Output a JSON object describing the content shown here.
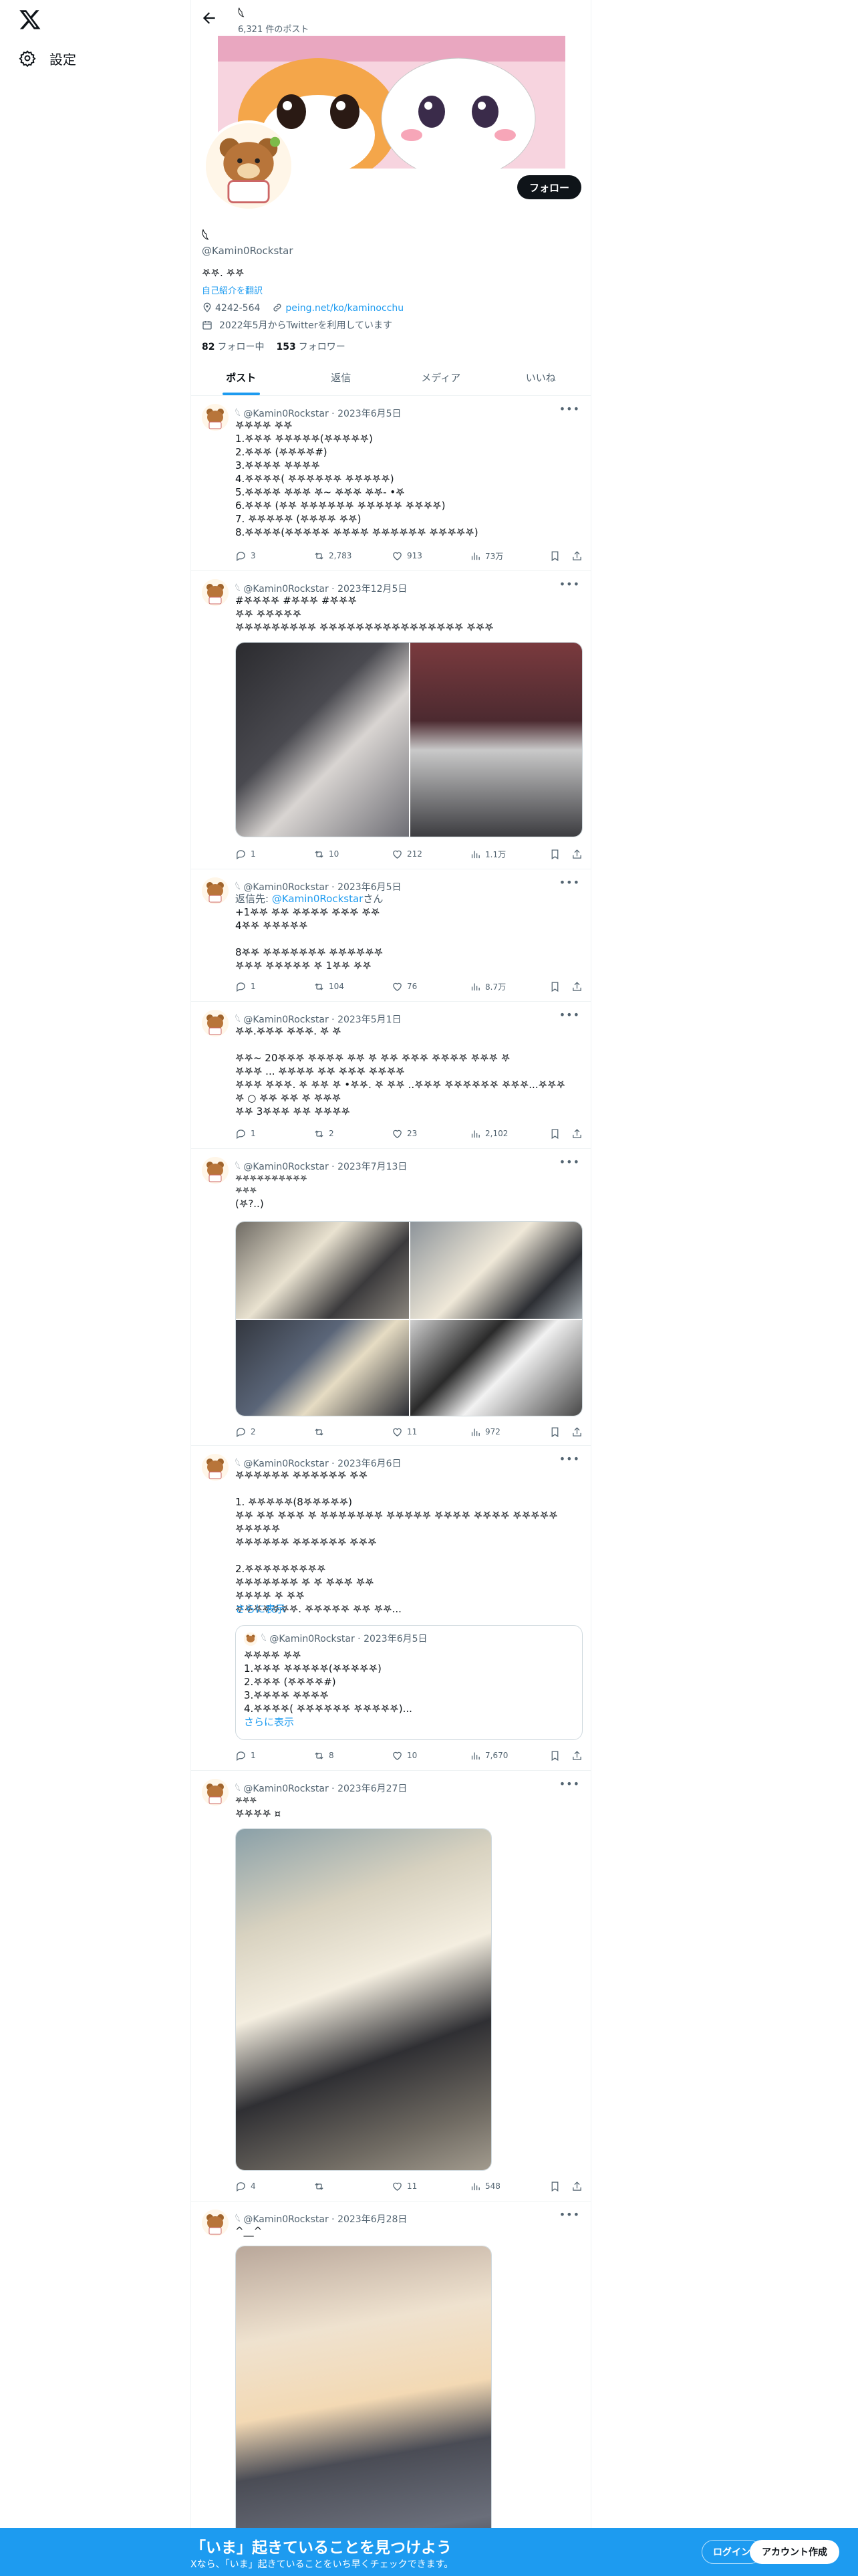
{
  "nav": {
    "settings_label": "設定"
  },
  "profile": {
    "name": "𓆩",
    "post_count": "6,321 件のポスト",
    "handle": "@Kamin0Rockstar",
    "bio": "𖤐𖤐. 𖤐𖤐",
    "translate": "自己紹介を翻訳",
    "location": "4242-564",
    "website": "peing.net/ko/kaminocchu",
    "joined": "2022年5月からTwitterを利用しています",
    "following_count": "82",
    "following_label": "フォロー中",
    "followers_count": "153",
    "followers_label": "フォロワー",
    "follow_button": "フォロー"
  },
  "tabs": [
    "ポスト",
    "返信",
    "メディア",
    "いいね"
  ],
  "posts": [
    {
      "header": "𓆩 @Kamin0Rockstar · 2023年6月5日",
      "text": "𖤐𖤐𖤐𖤐 𖤐𖤐\n1.𖤐𖤐𖤐 𖤐𖤐𖤐𖤐𖤐(𖤐𖤐𖤐𖤐𖤐)\n2.𖤐𖤐𖤐 (𖤐𖤐𖤐𖤐#)\n3.𖤐𖤐𖤐𖤐 𖤐𖤐𖤐𖤐\n4.𖤐𖤐𖤐𖤐( 𖤐𖤐𖤐𖤐𖤐𖤐 𖤐𖤐𖤐𖤐𖤐)\n5.𖤐𖤐𖤐𖤐 𖤐𖤐𖤐 𖤐~ 𖤐𖤐𖤐 𖤐𖤐- •𖤐\n6.𖤐𖤐𖤐 (𖤐𖤐 𖤐𖤐𖤐𖤐𖤐𖤐 𖤐𖤐𖤐𖤐𖤐 𖤐𖤐𖤐𖤐)\n7. 𖤐𖤐𖤐𖤐𖤐 (𖤐𖤐𖤐𖤐 𖤐𖤐)\n8.𖤐𖤐𖤐𖤐(𖤐𖤐𖤐𖤐𖤐 𖤐𖤐𖤐𖤐 𖤐𖤐𖤐𖤐𖤐𖤐 𖤐𖤐𖤐𖤐𖤐)",
      "replies": "3",
      "reposts": "2,783",
      "likes": "913",
      "views": "73万"
    },
    {
      "header": "𓆩 @Kamin0Rockstar · 2023年12月5日",
      "hashtags": "#𖤐𖤐𖤐𖤐 #𖤐𖤐𖤐 #𖤐𖤐𖤐",
      "text": "𖤐𖤐 𖤐𖤐𖤐𖤐𖤐\n𖤐𖤐𖤐𖤐𖤐𖤐𖤐𖤐𖤐 𖤐𖤐𖤐𖤐𖤐𖤐𖤐𖤐𖤐𖤐𖤐𖤐𖤐𖤐𖤐𖤐 𖤐𖤐𖤐",
      "replies": "1",
      "reposts": "10",
      "likes": "212",
      "views": "1.1万"
    },
    {
      "header": "𓆩 @Kamin0Rockstar · 2023年6月5日",
      "reply_prefix": "返信先: ",
      "reply_to": "@Kamin0Rockstar",
      "reply_suffix": "さん",
      "text": "+1𖤐𖤐 𖤐𖤐 𖤐𖤐𖤐𖤐 𖤐𖤐𖤐 𖤐𖤐\n4𖤐𖤐 𖤐𖤐𖤐𖤐𖤐\n\n8𖤐𖤐 𖤐𖤐𖤐𖤐𖤐𖤐𖤐 𖤐𖤐𖤐𖤐𖤐𖤐\n𖤐𖤐𖤐 𖤐𖤐𖤐𖤐𖤐 𖤐 1𖤐𖤐 𖤐𖤐",
      "replies": "1",
      "reposts": "104",
      "likes": "76",
      "views": "8.7万"
    },
    {
      "header": "𓆩 @Kamin0Rockstar · 2023年5月1日",
      "text": "𖤐𖤐.𖤐𖤐𖤐 𖤐𖤐𖤐. 𖤐 𖤐\n\n𖤐𖤐~ 20𖤐𖤐𖤐 𖤐𖤐𖤐𖤐 𖤐𖤐 𖤐 𖤐𖤐 𖤐𖤐𖤐 𖤐𖤐𖤐𖤐 𖤐𖤐𖤐 𖤐\n𖤐𖤐𖤐 ... 𖤐𖤐𖤐𖤐 𖤐𖤐 𖤐𖤐𖤐 𖤐𖤐𖤐𖤐\n𖤐𖤐𖤐 𖤐𖤐𖤐. 𖤐 𖤐𖤐 𖤐 •𖤐𖤐. 𖤐 𖤐𖤐 ..𖤐𖤐𖤐 𖤐𖤐𖤐𖤐𖤐𖤐 𖤐𖤐𖤐...𖤐𖤐𖤐\n𖤐 ○ 𖤐𖤐 𖤐𖤐 𖤐 𖤐𖤐𖤐\n𖤐𖤐 3𖤐𖤐𖤐 𖤐𖤐 𖤐𖤐𖤐𖤐",
      "replies": "1",
      "reposts": "2",
      "likes": "23",
      "views": "2,102"
    },
    {
      "header": "𓆩 @Kamin0Rockstar · 2023年7月13日",
      "small1": "𖤐𖤐𖤐𖤐𖤐𖤐𖤐𖤐𖤐𖤐",
      "small2": "𖤐𖤐𖤐",
      "text": "(𖤐?..)",
      "replies": "2",
      "reposts": "",
      "likes": "11",
      "views": "972"
    },
    {
      "header": "𓆩 @Kamin0Rockstar · 2023年6月6日",
      "text": "𖤐𖤐𖤐𖤐𖤐𖤐 𖤐𖤐𖤐𖤐𖤐𖤐 𖤐𖤐\n\n1. 𖤐𖤐𖤐𖤐𖤐(8𖤐𖤐𖤐𖤐𖤐)\n𖤐𖤐 𖤐𖤐 𖤐𖤐𖤐 𖤐 𖤐𖤐𖤐𖤐𖤐𖤐𖤐 𖤐𖤐𖤐𖤐𖤐 𖤐𖤐𖤐𖤐 𖤐𖤐𖤐𖤐 𖤐𖤐𖤐𖤐𖤐 𖤐𖤐𖤐𖤐𖤐\n𖤐𖤐𖤐𖤐𖤐𖤐 𖤐𖤐𖤐𖤐𖤐𖤐 𖤐𖤐𖤐\n\n2.𖤐𖤐𖤐𖤐𖤐𖤐𖤐𖤐𖤐\n𖤐𖤐𖤐𖤐𖤐𖤐𖤐 𖤐 𖤐 𖤐𖤐𖤐 𖤐𖤐\n𖤐𖤐𖤐𖤐 𖤐 𖤐𖤐\n𖤐𖤐𖤐𖤐𖤐𖤐𖤐. 𖤐𖤐𖤐𖤐𖤐 𖤐𖤐 𖤐𖤐...",
      "show_more": "さらに表示",
      "quote_header": "𓆩 @Kamin0Rockstar · 2023年6月5日",
      "quote_text": "𖤐𖤐𖤐𖤐 𖤐𖤐\n1.𖤐𖤐𖤐 𖤐𖤐𖤐𖤐𖤐(𖤐𖤐𖤐𖤐𖤐)\n2.𖤐𖤐𖤐 (𖤐𖤐𖤐𖤐#)\n3.𖤐𖤐𖤐𖤐 𖤐𖤐𖤐𖤐\n4.𖤐𖤐𖤐𖤐( 𖤐𖤐𖤐𖤐𖤐𖤐 𖤐𖤐𖤐𖤐𖤐)...",
      "quote_show_more": "さらに表示",
      "replies": "1",
      "reposts": "8",
      "likes": "10",
      "views": "7,670"
    },
    {
      "header": "𓆩 @Kamin0Rockstar · 2023年6月27日",
      "small1": "𖤐𖤐𖤐",
      "text": "𖤐𖤐𖤐𖤐 ¤",
      "replies": "4",
      "reposts": "",
      "likes": "11",
      "views": "548"
    },
    {
      "header": "𓆩 @Kamin0Rockstar · 2023年6月28日",
      "text": "^__^"
    }
  ],
  "bottom": {
    "title": "「いま」起きていることを見つけよう",
    "subtitle": "Xなら、「いま」起きていることをいち早くチェックできます。",
    "login": "ログイン",
    "signup": "アカウント作成"
  }
}
